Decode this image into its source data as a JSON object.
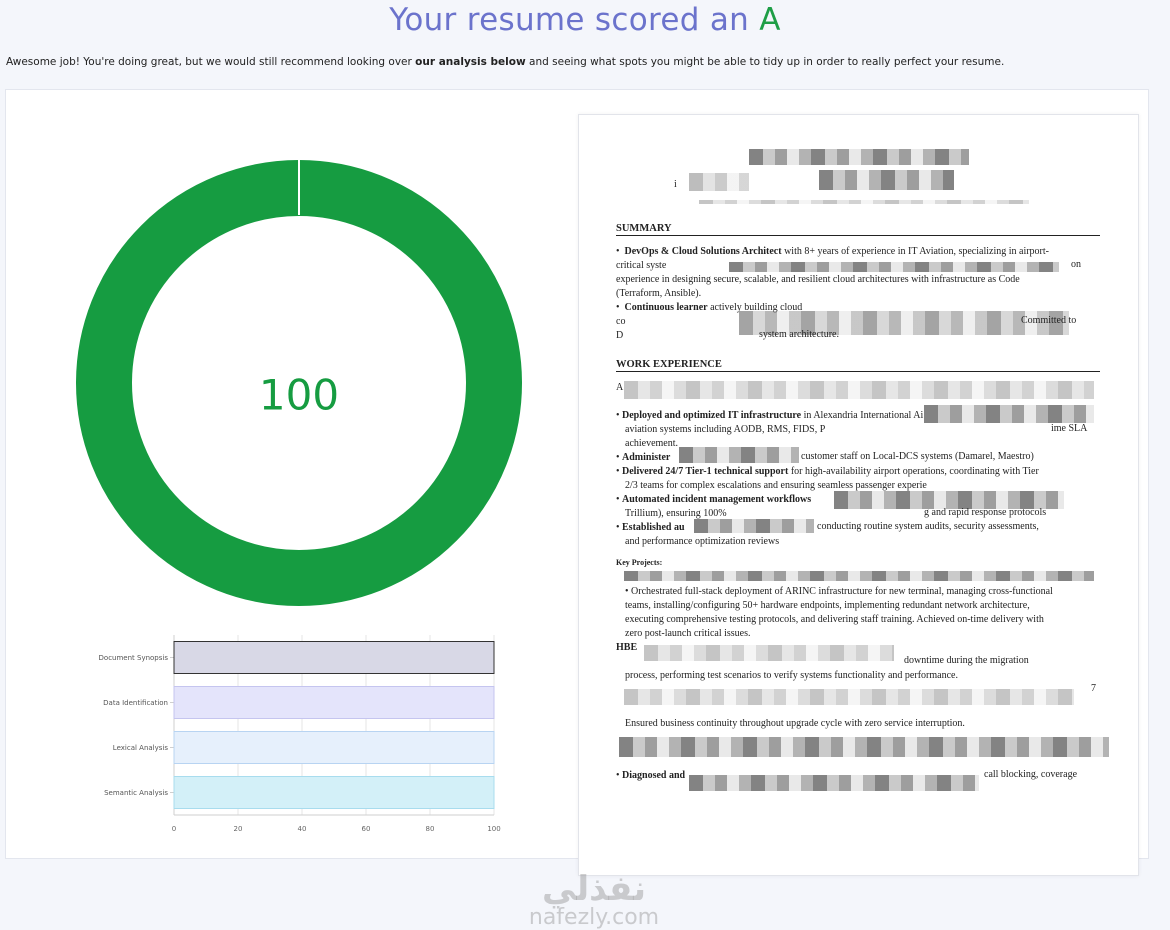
{
  "header": {
    "title_prefix": "Your resume scored an",
    "grade": "A"
  },
  "intro": {
    "before": "Awesome job! You're doing great, but we would still recommend looking over ",
    "bold": "our analysis below",
    "after": " and seeing what spots you might be able to tidy up in order to really perfect your resume."
  },
  "score": {
    "value": "100",
    "percent": 100,
    "color": "#169c41"
  },
  "chart_data": {
    "type": "bar",
    "orientation": "horizontal",
    "categories": [
      "Document Synopsis",
      "Data Identification",
      "Lexical Analysis",
      "Semantic Analysis"
    ],
    "values": [
      100,
      100,
      100,
      100
    ],
    "xlim": [
      0,
      100
    ],
    "xticks": [
      "0",
      "20",
      "40",
      "60",
      "80",
      "100"
    ],
    "colors": [
      "#d8d8e6",
      "#e4e4fb",
      "#e6f0fc",
      "#d3f0f8"
    ],
    "edge_colors": [
      "#333333",
      "#c5c5ef",
      "#b8d4f2",
      "#a8dcee"
    ]
  },
  "resume": {
    "summary_heading": "SUMMARY",
    "summary": [
      {
        "bold": "DevOps & Cloud Solutions Architect",
        "text": " with 8+ years of experience in IT Aviation, specializing in airport-"
      },
      {
        "bold": "",
        "text": "critical syste"
      },
      {
        "bold": "",
        "text": "experience in designing secure, scalable, and resilient cloud architectures with infrastructure as Code"
      },
      {
        "bold": "",
        "text": "(Terraform, Ansible)."
      },
      {
        "bold": "Continuous learner",
        "text": " actively building cloud"
      },
      {
        "bold": "",
        "text": "co"
      },
      {
        "bold": "",
        "text": "D"
      }
    ],
    "summary_tail_1": "Committed to",
    "summary_tail_2": "system architecture.",
    "summary_tail_3": "on",
    "experience_heading": "WORK EXPERIENCE",
    "experience": [
      {
        "bold": "Deployed and optimized IT infrastructure",
        "text": " in Alexandria International Ai"
      },
      {
        "bold": "",
        "text": "aviation systems including AODB, RMS, FIDS, P"
      },
      {
        "bold": "",
        "text": "achievement."
      },
      {
        "bold": "Administer",
        "text": ""
      },
      {
        "bold": "Delivered 24/7 Tier-1 technical support",
        "text": " for high-availability airport operations, coordinating with Tier"
      },
      {
        "bold": "",
        "text": "2/3 teams for complex escalations and ensuring seamless passenger experie"
      },
      {
        "bold": "Automated incident management workflows",
        "text": ""
      },
      {
        "bold": "",
        "text": "Trillium), ensuring 100%"
      },
      {
        "bold": "Established au",
        "text": ""
      },
      {
        "bold": "",
        "text": "and performance optimization reviews"
      }
    ],
    "exp_tail_1": "ime SLA",
    "exp_tail_2": "customer staff on Local-DCS systems (Damarel, Maestro)",
    "exp_tail_3": "g and rapid response protocols",
    "exp_tail_4": "conducting routine system audits, security assessments,",
    "projects_label": "Key Projects:",
    "projects": [
      "Orchestrated full-stack deployment of ARINC infrastructure for new terminal, managing cross-functional",
      "teams, installing/configuring 50+ hardware endpoints, implementing redundant network architecture,",
      "executing comprehensive testing protocols, and delivering staff training. Achieved on-time delivery with",
      "zero post-launch critical issues."
    ],
    "hbe_label": "HBE",
    "hbe_1": "downtime during the migration",
    "hbe_2": "process, performing test scenarios to verify systems functionality and performance.",
    "page_mark": "7",
    "continuity": "Ensured business continuity throughout upgrade cycle with zero service interruption.",
    "diag_bold": "Diagnosed and",
    "diag_tail": "call blocking, coverage",
    "a_letter": "A"
  },
  "watermark": {
    "arabic": "نفذلي",
    "latin": "nafezly.com"
  }
}
